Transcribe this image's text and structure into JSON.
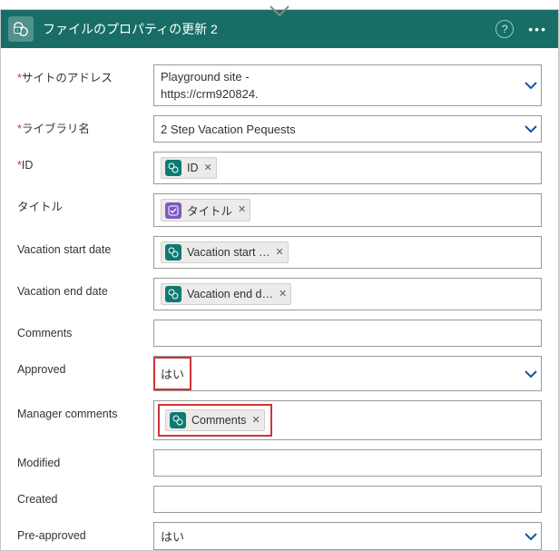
{
  "header": {
    "title": "ファイルのプロパティの更新 2"
  },
  "fields": {
    "siteAddress": {
      "label": "サイトのアドレス",
      "value_a": "Playground site -",
      "value_b": "https://crm920824."
    },
    "library": {
      "label": "ライブラリ名",
      "value": "2 Step Vacation Pequests"
    },
    "id": {
      "label": "ID",
      "token": "ID"
    },
    "titleField": {
      "label": "タイトル",
      "token": "タイトル"
    },
    "vacStart": {
      "label": "Vacation start date",
      "token": "Vacation start …"
    },
    "vacEnd": {
      "label": "Vacation end date",
      "token": "Vacation end d…"
    },
    "comments": {
      "label": "Comments"
    },
    "approved": {
      "label": "Approved",
      "value": "はい"
    },
    "mgrComments": {
      "label": "Manager comments",
      "token": "Comments"
    },
    "modified": {
      "label": "Modified"
    },
    "created": {
      "label": "Created"
    },
    "preApproved": {
      "label": "Pre-approved",
      "value": "はい"
    }
  }
}
